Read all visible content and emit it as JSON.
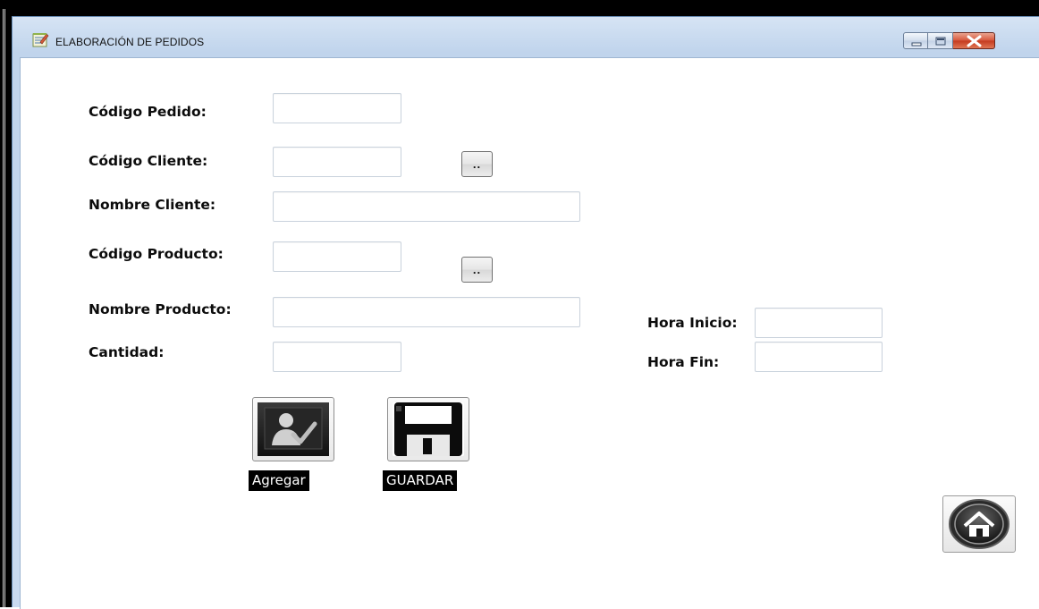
{
  "window": {
    "title": "ELABORACIÓN DE PEDIDOS",
    "icon": "form-app-icon",
    "controls": [
      "minimize-icon",
      "maximize-icon",
      "close-icon"
    ]
  },
  "form": {
    "codigo_pedido": {
      "label": "Código Pedido:",
      "value": ""
    },
    "codigo_cliente": {
      "label": "Código Cliente:",
      "value": "",
      "browse_label": ".."
    },
    "nombre_cliente": {
      "label": "Nombre Cliente:",
      "value": ""
    },
    "codigo_producto": {
      "label": "Código Producto:",
      "value": "",
      "browse_label": ".."
    },
    "nombre_producto": {
      "label": "Nombre Producto:",
      "value": ""
    },
    "cantidad": {
      "label": "Cantidad:",
      "value": ""
    },
    "hora_inicio": {
      "label": "Hora Inicio:",
      "value": ""
    },
    "hora_fin": {
      "label": "Hora Fin:",
      "value": ""
    }
  },
  "actions": {
    "agregar": {
      "label": "Agregar",
      "icon": "add-user-icon"
    },
    "guardar": {
      "label": "GUARDAR",
      "icon": "floppy-disk-icon"
    },
    "home": {
      "icon": "home-icon"
    }
  },
  "colors": {
    "titlebar": "#c9daf0",
    "close_button": "#d6553a",
    "caption_bg": "#000000",
    "caption_text": "#ffffff"
  }
}
